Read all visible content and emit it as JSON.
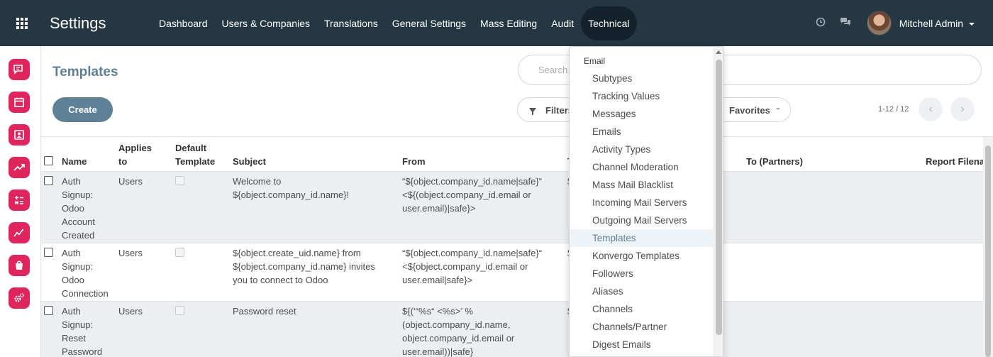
{
  "app": {
    "brand": "Settings"
  },
  "nav": {
    "menu": [
      "Dashboard",
      "Users & Companies",
      "Translations",
      "General Settings",
      "Mass Editing",
      "Audit",
      "Technical"
    ],
    "user": "Mitchell Admin",
    "icons": [
      "clock-icon",
      "chat-icon"
    ]
  },
  "sidebar": {
    "icons": [
      "discuss-icon",
      "calendar-icon",
      "contacts-icon",
      "crm-icon",
      "invoicing-icon",
      "dashboards-icon",
      "sales-icon",
      "settings-icon"
    ]
  },
  "control": {
    "title": "Templates",
    "create": "Create",
    "search_placeholder": "Search...",
    "filters": "Filters",
    "favorites": "Favorites",
    "pager": "1-12 / 12"
  },
  "list": {
    "headers": {
      "name": "Name",
      "applies_1": "Applies",
      "applies_2": "to",
      "default_1": "Default",
      "default_2": "Template",
      "subject": "Subject",
      "from": "From",
      "to_partners": "To (Partners)",
      "report_filename": "Report Filena"
    },
    "rows": [
      {
        "name": [
          "Auth",
          "Signup:",
          "Odoo",
          "Account",
          "Created"
        ],
        "applies": "Users",
        "subject": [
          "Welcome to",
          "${object.company_id.name}!"
        ],
        "from": [
          "“${object.company_id.name|safe}“",
          "<${(object.company_id.email or",
          "user.email)|safe}>"
        ],
        "to_cut": "$"
      },
      {
        "name": [
          "Auth",
          "Signup:",
          "Odoo",
          "Connection"
        ],
        "applies": "Users",
        "subject": [
          "${object.create_uid.name} from",
          "${object.company_id.name} invites",
          "you to connect to Odoo"
        ],
        "from": [
          "“${object.company_id.name|safe}“",
          "<${object.company_id.email or",
          "user.email|safe}>"
        ],
        "to_cut": "$"
      },
      {
        "name": [
          "Auth",
          "Signup:",
          "Reset",
          "Password"
        ],
        "applies": "Users",
        "subject": [
          "Password reset"
        ],
        "from": [
          "${(‘“%s“ <%s>’ %",
          "(object.company_id.name,",
          "object.company_id.email or",
          "user.email))|safe}"
        ],
        "to_cut": "$"
      }
    ]
  },
  "dropdown": {
    "header": "Email",
    "items": [
      "Subtypes",
      "Tracking Values",
      "Messages",
      "Emails",
      "Activity Types",
      "Channel Moderation",
      "Mass Mail Blacklist",
      "Incoming Mail Servers",
      "Outgoing Mail Servers",
      "Templates",
      "Konvergo Templates",
      "Followers",
      "Aliases",
      "Channels",
      "Channels/Partner",
      "Digest Emails"
    ],
    "active": "Templates"
  },
  "colors": {
    "navbar": "#243742",
    "accent": "#5f8197",
    "app_icon": "#e0245e",
    "row_alt": "#eceff2"
  }
}
